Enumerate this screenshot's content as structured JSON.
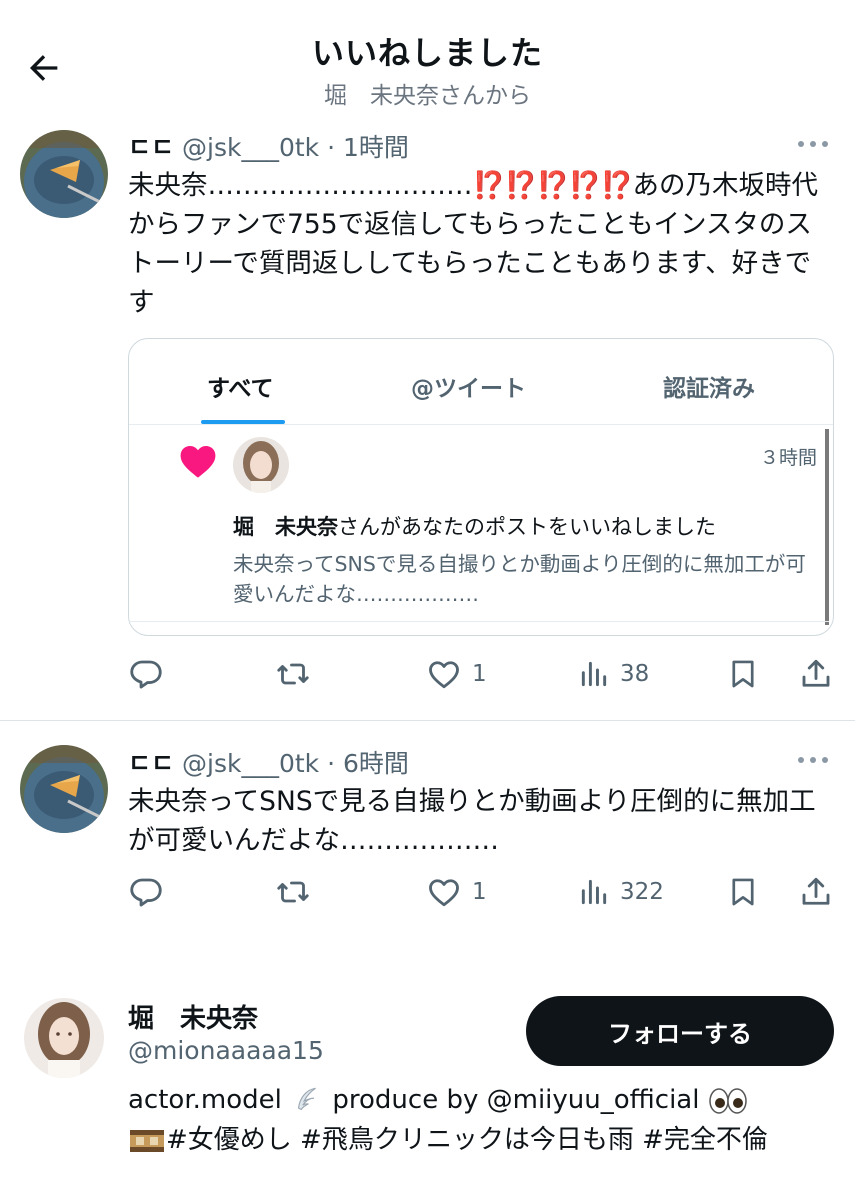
{
  "header": {
    "title": "いいねしました",
    "subtitle": "堀　未央奈さんから"
  },
  "posts": [
    {
      "display_name": "ㄷㄷ",
      "handle": "@jsk___0tk",
      "time": "1時間",
      "text_before": "未央奈…………………………",
      "text_emphasis": "⁉️⁉️⁉️⁉️⁉️",
      "text_after": "あの乃木坂時代からファンで755で返信してもらったこともインスタのストーリーで質問返ししてもらったこともあります、好きです",
      "embed": {
        "tabs": [
          "すべて",
          "@ツイート",
          "認証済み"
        ],
        "notif_time": "３時間",
        "notif_name": "堀　未央奈",
        "notif_action": "さんがあなたのポストをいいねしました",
        "notif_quote": "未央奈ってSNSで見る自撮りとか動画より圧倒的に無加工が可愛いんだよな………………"
      },
      "stats": {
        "likes": "1",
        "views": "38"
      }
    },
    {
      "display_name": "ㄷㄷ",
      "handle": "@jsk___0tk",
      "time": "6時間",
      "text": "未央奈ってSNSで見る自撮りとか動画より圧倒的に無加工が可愛いんだよな………………",
      "stats": {
        "likes": "1",
        "views": "322"
      }
    }
  ],
  "profile": {
    "name": "堀　未央奈",
    "handle": "@mionaaaaa15",
    "follow_label": "フォローする",
    "bio_line1_a": "actor.model",
    "bio_line1_b": "produce by @miiyuu_official",
    "bio_line2": "#女優めし #飛鳥クリニックは今日も雨 #完全不倫"
  },
  "colors": {
    "text": "#0f1419",
    "muted": "#536471",
    "accent": "#1d9bf0",
    "heart": "#f91880",
    "button_bg": "#0f1419"
  },
  "icons": [
    "back-arrow-icon",
    "more-icon",
    "reply-icon",
    "retweet-icon",
    "like-icon",
    "views-icon",
    "bookmark-icon",
    "share-icon",
    "heart-icon",
    "angel-wing-icon",
    "eyes-icon",
    "film-icon"
  ]
}
